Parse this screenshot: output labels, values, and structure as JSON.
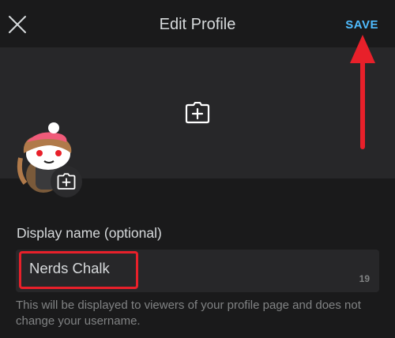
{
  "header": {
    "title": "Edit Profile",
    "save_label": "SAVE",
    "close_icon": "close-icon"
  },
  "banner": {
    "camera_icon": "add-photo-icon"
  },
  "avatar": {
    "camera_icon": "add-photo-icon"
  },
  "form": {
    "display_name_label": "Display name (optional)",
    "display_name_value": "Nerds Chalk",
    "remaining_chars": "19",
    "helper_text": "This will be displayed to viewers of your profile page and does not change your username."
  },
  "colors": {
    "accent": "#4fbcff",
    "annotation": "#e8202a",
    "background": "#1a1a1b",
    "surface": "#272729"
  }
}
